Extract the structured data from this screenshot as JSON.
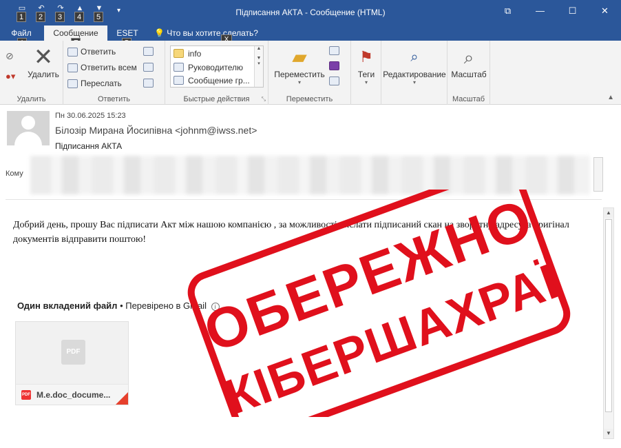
{
  "window": {
    "title": "Підписання АКТА - Сообщение (HTML)",
    "qat_keytips": [
      "1",
      "2",
      "3",
      "4",
      "5"
    ],
    "controls": {
      "restore": "⧉",
      "minimize": "—",
      "maximize": "☐",
      "close": "✕"
    }
  },
  "tabs": [
    {
      "label": "Файл",
      "keytip": "Ф"
    },
    {
      "label": "Сообщение",
      "keytip": "Я"
    },
    {
      "label": "ESET",
      "keytip": "Э"
    }
  ],
  "tell_me": {
    "placeholder": "Что вы хотите сделать?",
    "keytip": "X"
  },
  "ribbon": {
    "delete_group": {
      "button": "Удалить",
      "label": "Удалить"
    },
    "respond_group": {
      "reply": "Ответить",
      "reply_all": "Ответить всем",
      "forward": "Переслать",
      "label": "Ответить"
    },
    "quick_steps": {
      "items": [
        "info",
        "Руководителю",
        "Сообщение гр..."
      ],
      "label": "Быстрые действия"
    },
    "move_group": {
      "button": "Переместить",
      "label": "Переместить"
    },
    "tags_group": {
      "button": "Теги"
    },
    "editing_group": {
      "button": "Редактирование"
    },
    "zoom_group": {
      "button": "Масштаб",
      "label": "Масштаб"
    }
  },
  "header": {
    "date": "Пн 30.06.2025 15:23",
    "from": "Білозір Мирана Йосипівна <johnm@iwss.net>",
    "subject": "Підписання АКТА",
    "to_label": "Кому"
  },
  "body": {
    "text": "Добрий день, прошу Вас підписати Акт між нашою компанією , за можливості вислати підписаний скан на зворотну адресу, а оригінал документів відправити поштою!",
    "attachment_heading": "Один вкладений файл",
    "attachment_scan": "Перевірено в Gmail",
    "attachment_preview_icon": "PDF",
    "attachment_badge": "PDF",
    "attachment_name": "M.e.doc_docume..."
  },
  "stamp": {
    "line1": "ОБЕРЕЖНО",
    "line2": "КІБЕРШАХРАЇ",
    "color": "#e0101c"
  },
  "colors": {
    "titlebar": "#2b579a",
    "ribbon": "#f3f3f3"
  }
}
